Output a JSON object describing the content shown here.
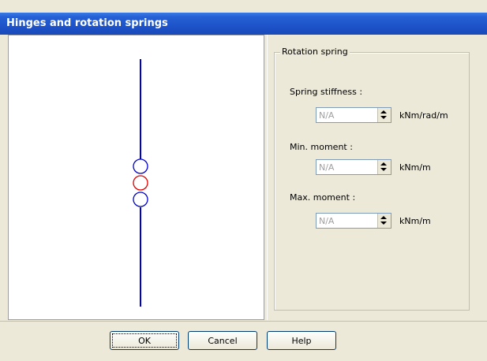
{
  "window": {
    "title": "Hinges and rotation springs"
  },
  "groupbox": {
    "title": "Rotation spring"
  },
  "fields": [
    {
      "label": "Spring stiffness :",
      "value": "N/A",
      "unit": "kNm/rad/m"
    },
    {
      "label": "Min. moment :",
      "value": "N/A",
      "unit": "kNm/m"
    },
    {
      "label": "Max. moment :",
      "value": "N/A",
      "unit": "kNm/m"
    }
  ],
  "buttons": {
    "ok_label": "OK",
    "cancel_label": "Cancel",
    "help_label": "Help"
  },
  "colors": {
    "beam": "#0000cc",
    "hinge_outer": "#0000cc",
    "hinge_selected": "#e00000"
  }
}
